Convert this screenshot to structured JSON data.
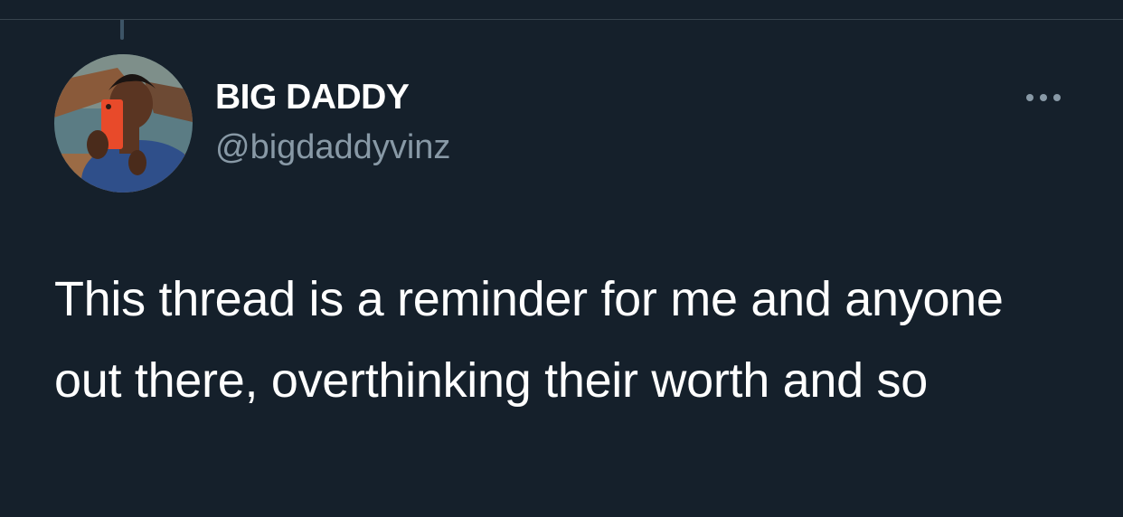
{
  "tweet": {
    "author": {
      "display_name": "BIG DADDY",
      "handle": "@bigdaddyvinz",
      "avatar_icon": "profile-photo"
    },
    "more_icon": "more-options-icon",
    "text": "This thread is a reminder for me and anyone out there, overthinking their worth and so"
  },
  "colors": {
    "background": "#15202b",
    "primary_text": "#ffffff",
    "secondary_text": "#8899a6",
    "divider": "#38444d",
    "thread_line": "#3d5466"
  }
}
